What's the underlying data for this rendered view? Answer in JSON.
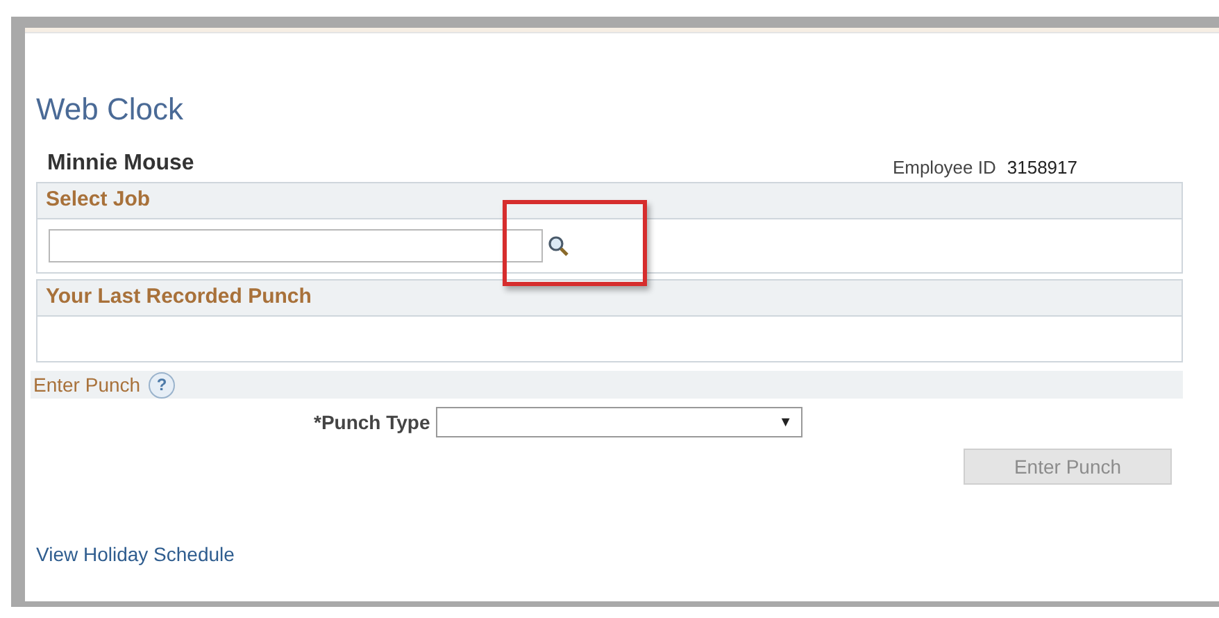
{
  "page_title": "Web Clock",
  "employee": {
    "name": "Minnie Mouse",
    "id_label": "Employee ID",
    "id_value": "3158917"
  },
  "select_job": {
    "title": "Select Job",
    "highlighted": true
  },
  "last_punch": {
    "title": "Your Last Recorded Punch"
  },
  "enter_punch": {
    "title": "Enter Punch",
    "help": "?",
    "punch_type_label": "*Punch Type",
    "dropdown_arrow": "▼",
    "button": {
      "label": "Enter Punch",
      "disabled": true
    }
  },
  "link": "View Holiday Schedule"
}
